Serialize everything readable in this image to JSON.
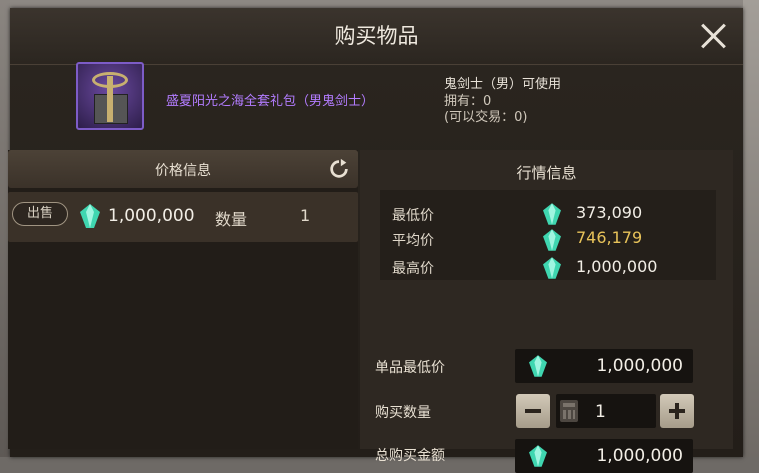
{
  "window": {
    "title": "购买物品",
    "close_icon": "close-icon"
  },
  "item": {
    "name": "盛夏阳光之海全套礼包（男鬼剑士）",
    "usable_by": "鬼剑士（男）可使用",
    "owned": "拥有：0",
    "tradable": "(可以交易：0)",
    "name_color": "#b37cff"
  },
  "price_panel": {
    "header": "价格信息",
    "refresh_icon": "refresh-icon",
    "listing": {
      "badge": "出售",
      "price": "1,000,000",
      "qty_label": "数量",
      "qty": "1"
    }
  },
  "market": {
    "title": "行情信息",
    "rows": [
      {
        "label": "最低价",
        "value": "373,090",
        "color": "#f2eee6"
      },
      {
        "label": "平均价",
        "value": "746,179",
        "color": "#e8c35a"
      },
      {
        "label": "最高价",
        "value": "1,000,000",
        "color": "#f2eee6"
      }
    ]
  },
  "purchase": {
    "unit_min_label": "单品最低价",
    "unit_min_value": "1,000,000",
    "qty_label": "购买数量",
    "qty_value": "1",
    "total_label": "总购买金额",
    "total_value": "1,000,000"
  },
  "colors": {
    "gem": "#3fd6b0",
    "accent_gold": "#e8c35a"
  }
}
